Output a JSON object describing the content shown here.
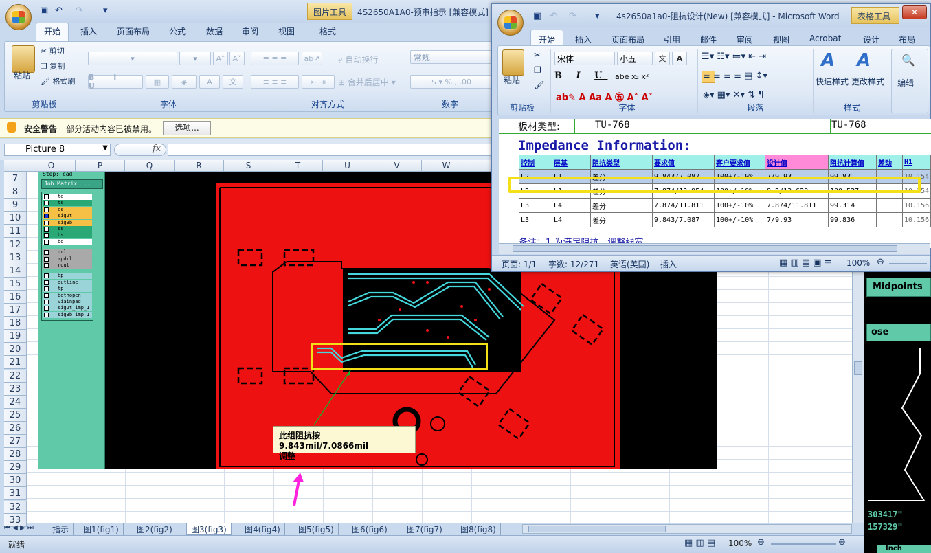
{
  "excel": {
    "quick_access": [
      "save-icon",
      "undo-icon",
      "redo-icon"
    ],
    "context_tab": "图片工具",
    "title": "4S2650A1A0-预审指示 [兼容模式]",
    "tabs": [
      "开始",
      "插入",
      "页面布局",
      "公式",
      "数据",
      "审阅",
      "视图",
      "格式"
    ],
    "clipboard": {
      "paste": "粘贴",
      "cut": "剪切",
      "copy": "复制",
      "format_painter": "格式刷",
      "label": "剪贴板"
    },
    "font_label": "字体",
    "align": {
      "wrap": "自动换行",
      "merge": "合并后居中",
      "label": "对齐方式"
    },
    "number": {
      "format": "常规",
      "label": "数字"
    },
    "security": {
      "title": "安全警告",
      "message": "部分活动内容已被禁用。",
      "options": "选项..."
    },
    "name_box": "Picture 8",
    "fx": "fx",
    "columns": [
      "O",
      "P",
      "Q",
      "R",
      "S",
      "T",
      "U",
      "V",
      "W"
    ],
    "rows": [
      "7",
      "8",
      "9",
      "10",
      "11",
      "12",
      "13",
      "14",
      "15",
      "16",
      "17",
      "18",
      "19",
      "20",
      "21",
      "22",
      "23",
      "24",
      "25",
      "26",
      "27",
      "28",
      "29",
      "30",
      "31",
      "32",
      "33"
    ],
    "sheet_tabs": [
      "指示",
      "图1(fig1)",
      "图2(fig2)",
      "图3(fig3)",
      "图4(fig4)",
      "图5(fig5)",
      "图6(fig6)",
      "图7(fig7)",
      "图8(fig8)"
    ],
    "active_sheet": "图3(fig3)",
    "status": "就绪",
    "zoom": "100%"
  },
  "job_matrix": {
    "step": "Step: cad",
    "title": "Job Matrix ...",
    "layers_a": [
      "to",
      "ts",
      "cs",
      "sig2t",
      "sig3b",
      "ss",
      "bs",
      "bo"
    ],
    "layers_b": [
      "drl",
      "mpdrl",
      "rout"
    ],
    "layers_c": [
      "bp",
      "outline",
      "tp",
      "bothopen",
      "viainpad",
      "sig2t_imp_1",
      "sig3b_imp_1"
    ]
  },
  "callout": {
    "line1": "此组阻抗按9.843mil/7.0866mil",
    "line2": "调整"
  },
  "word": {
    "title": "4s2650a1a0-阻抗设计(New) [兼容模式] - Microsoft Word",
    "context_tab": "表格工具",
    "tabs": [
      "开始",
      "插入",
      "页面布局",
      "引用",
      "邮件",
      "审阅",
      "视图",
      "Acrobat",
      "设计",
      "布局"
    ],
    "font": "宋体",
    "size": "小五",
    "paste": "粘贴",
    "clipboard_label": "剪贴板",
    "font_label": "字体",
    "para_label": "段落",
    "quick_styles": "快速样式",
    "change_styles": "更改样式",
    "styles_label": "样式",
    "edit": "编辑",
    "material_label": "板材类型:",
    "material_value": "TU-768",
    "material_value2": "TU-768",
    "heading": "Impedance Information:",
    "table_headers": [
      "控制",
      "层基",
      "阻抗类型",
      "要求值",
      "客户要求值",
      "设计值",
      "阻抗计算值",
      "差动",
      "H1"
    ],
    "table_rows": [
      [
        "L2",
        "L1",
        "差分",
        "9.843/7.087",
        "100+/-10%",
        "7/9.93",
        "99.831",
        "",
        "10.154"
      ],
      [
        "L2",
        "L1",
        "差分",
        "7.874/13.954",
        "100+/-10%",
        "8.2/13.628",
        "100.527",
        "",
        "10.154"
      ],
      [
        "L3",
        "L4",
        "差分",
        "7.874/11.811",
        "100+/-10%",
        "7.874/11.811",
        "99.314",
        "",
        "10.156"
      ],
      [
        "L3",
        "L4",
        "差分",
        "9.843/7.087",
        "100+/-10%",
        "7/9.93",
        "99.836",
        "",
        "10.156"
      ]
    ],
    "note": "备注：1.为满足阻抗，调整线宽",
    "status": {
      "page": "页面: 1/1",
      "words": "字数: 12/271",
      "lang": "英语(美国)",
      "mode": "插入",
      "zoom": "100%"
    }
  },
  "right_panel": {
    "button1": "Midpoints",
    "button2": "ose",
    "coord1": "303417\"",
    "coord2": "157329\"",
    "unit": "Inch"
  },
  "colors": {
    "pcb_red": "#ee1111",
    "trace": "#44d8dc",
    "highlight": "#f3e019",
    "arrow": "#ff22dd"
  }
}
